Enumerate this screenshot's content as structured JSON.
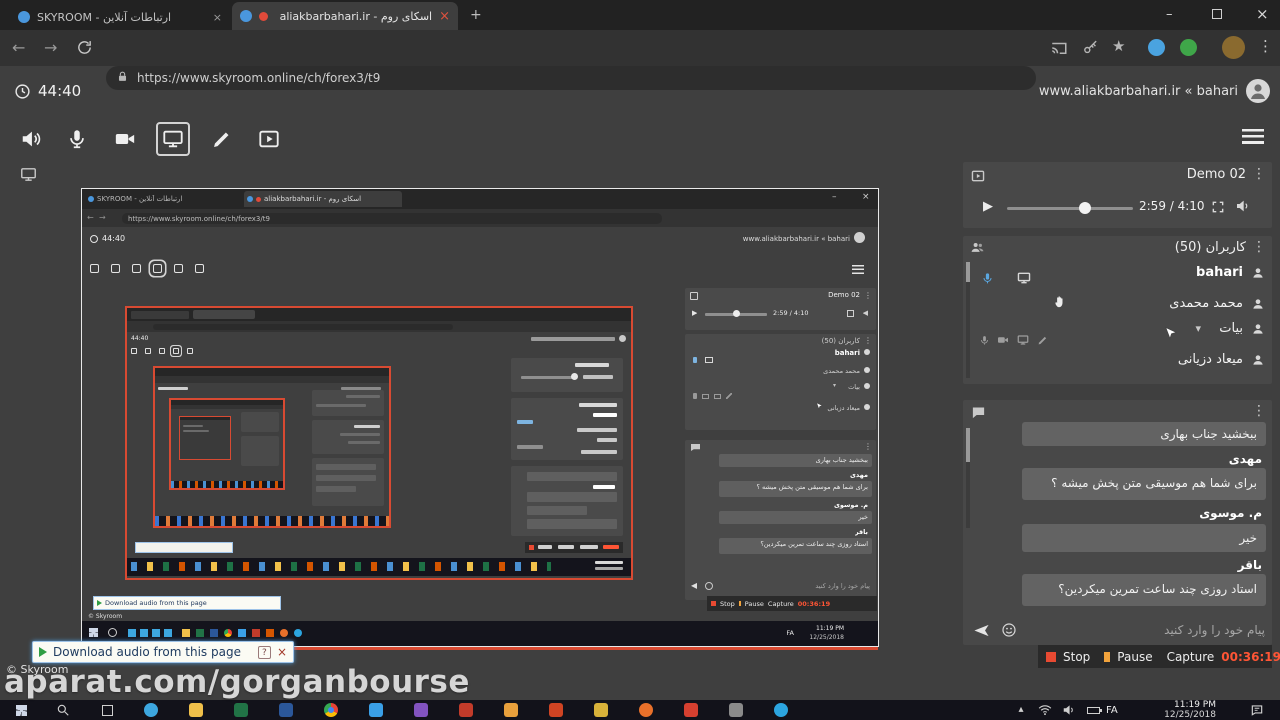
{
  "colors": {
    "record_red": "#e84a32",
    "pause_orange": "#f2a33c",
    "capture_time_red": "#ff5535",
    "accent_blue": "#4aa3e0",
    "capture_frame_red": "#d84a32"
  },
  "browser": {
    "tab1": "SKYROOM - ارتباطات آنلاین",
    "tab2": "اسکای روم - aliakbarbahari.ir",
    "url": "https://www.skyroom.online/ch/forex3/t9"
  },
  "header": {
    "timer": "44:40",
    "site": "www.aliakbarbahari.ir « bahari"
  },
  "video": {
    "title": "Demo 02",
    "time": "2:59 / 4:10"
  },
  "users": {
    "title": "کاربران (50)",
    "list": [
      {
        "name": "bahari"
      },
      {
        "name": "محمد محمدی"
      },
      {
        "name": "بیات"
      },
      {
        "name": "میعاد دزیانی"
      }
    ]
  },
  "chat": {
    "messages": [
      {
        "text": "ببخشید جناب بهاری"
      },
      {
        "author": "مهدی",
        "text": "برای شما هم موسیقی متن پخش میشه ؟"
      },
      {
        "author": "م. موسوی",
        "text": "خیر"
      },
      {
        "author": "باقر",
        "text": "استاد روزی چند ساعت تمرین میکردین؟"
      }
    ],
    "placeholder": "پیام خود را وارد کنید"
  },
  "infobar": {
    "text": "Download audio from this page"
  },
  "page": {
    "copyright": "© Skyroom"
  },
  "recorder": {
    "stop": "Stop",
    "pause": "Pause",
    "capture": "Capture",
    "time": "00:36:19"
  },
  "taskbar": {
    "lang": "FA",
    "time": "11:19 PM",
    "date": "12/25/2018"
  },
  "watermark": "aparat.com/gorganbourse",
  "icons": {
    "menu": "⋮ / ☰",
    "play": "▶",
    "send": "◀",
    "star": "★",
    "caret": "▾"
  }
}
